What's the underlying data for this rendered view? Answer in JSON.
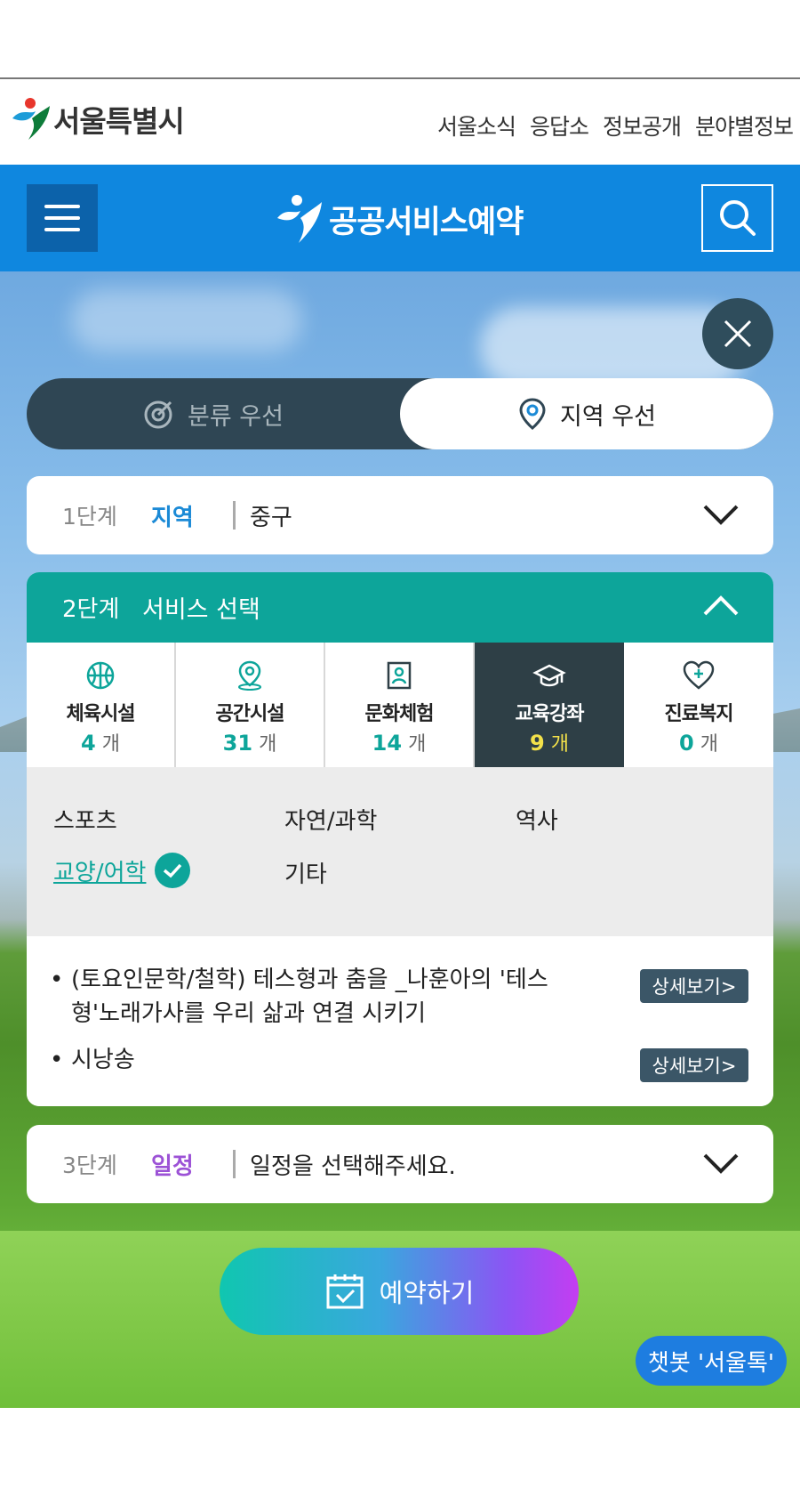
{
  "seoul": {
    "logo_text": "서울특별시",
    "links": [
      "서울소식",
      "응답소",
      "정보공개",
      "분야별정보"
    ]
  },
  "service": {
    "title": "공공서비스예약"
  },
  "toggle": {
    "left_label": "분류 우선",
    "right_label": "지역 우선"
  },
  "step1": {
    "num": "1단계",
    "key": "지역",
    "value": "중구"
  },
  "step2": {
    "num": "2단계",
    "key": "서비스 선택",
    "categories": [
      {
        "name": "체육시설",
        "count": "4",
        "unit": "개",
        "icon": "basketball-icon"
      },
      {
        "name": "공간시설",
        "count": "31",
        "unit": "개",
        "icon": "location-pin-icon"
      },
      {
        "name": "문화체험",
        "count": "14",
        "unit": "개",
        "icon": "culture-frame-icon"
      },
      {
        "name": "교육강좌",
        "count": "9",
        "unit": "개",
        "icon": "graduation-cap-icon",
        "active": true
      },
      {
        "name": "진료복지",
        "count": "0",
        "unit": "개",
        "icon": "heart-plus-icon"
      }
    ],
    "subcategories": [
      "스포츠",
      "자연/과학",
      "역사",
      "교양/어학",
      "기타"
    ],
    "selected_subcategory": "교양/어학",
    "items": [
      {
        "text": "(토요인문학/철학) 테스형과 춤을 _나훈아의 '테스형'노래가사를 우리 삶과 연결 시키기",
        "button": "상세보기>"
      },
      {
        "text": "시낭송",
        "button": "상세보기>"
      }
    ]
  },
  "step3": {
    "num": "3단계",
    "key": "일정",
    "value": "일정을 선택해주세요."
  },
  "reserve_label": "예약하기",
  "chatbot_label": "챗봇 '서울톡'",
  "colors": {
    "brand_blue": "#0f87df",
    "teal": "#0da59a",
    "dark_slate": "#2f4654",
    "purple": "#9c52d6",
    "yellow": "#f3e14a"
  }
}
